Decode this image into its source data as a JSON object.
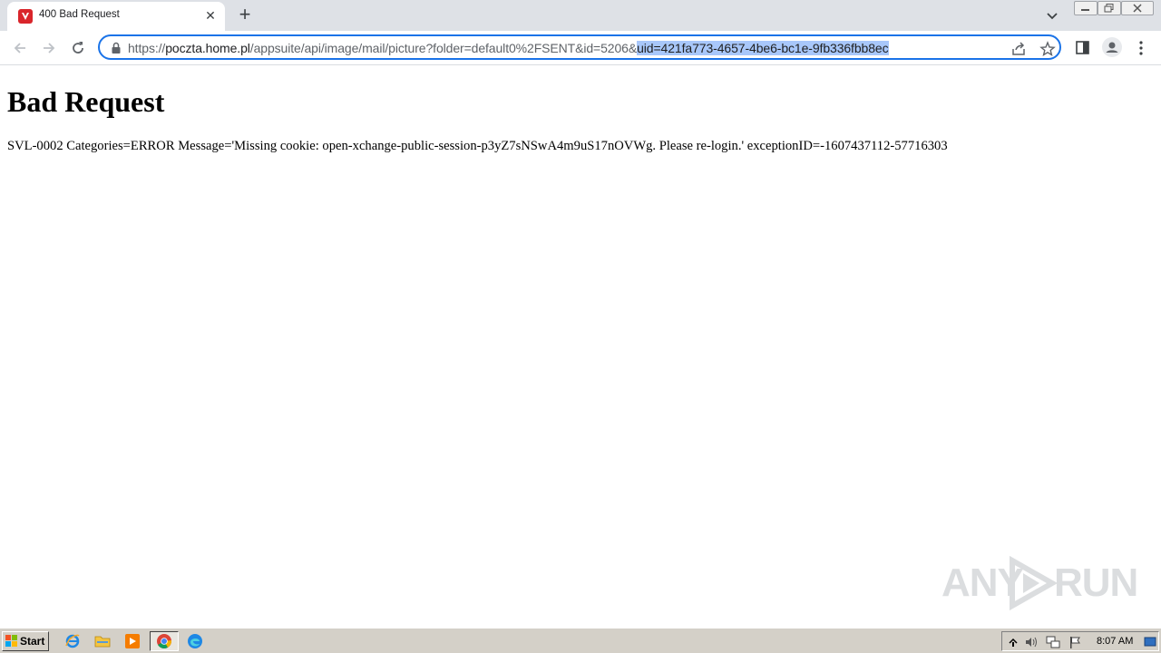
{
  "browser": {
    "tab": {
      "title": "400 Bad Request",
      "favicon": "anyrun-red-icon"
    },
    "address": {
      "scheme": "https://",
      "host": "poczta.home.pl",
      "path": "/appsuite/api/image/mail/picture?folder=default0%2FSENT&id=5206&",
      "selected": "uid=421fa773-4657-4be6-bc1e-9fb336fbb8ec"
    }
  },
  "page": {
    "heading": "Bad Request",
    "message": "SVL-0002 Categories=ERROR Message='Missing cookie: open-xchange-public-session-p3yZ7sNSwA4m9uS17nOVWg. Please re-login.' exceptionID=-1607437112-57716303"
  },
  "watermark": {
    "left": "ANY",
    "right": "RUN"
  },
  "taskbar": {
    "start_label": "Start",
    "clock": "8:07 AM"
  },
  "colors": {
    "accent": "#1a73e8",
    "selection": "#a8c7fa",
    "tab_strip": "#dee1e6",
    "taskbar": "#d4d0c8"
  }
}
